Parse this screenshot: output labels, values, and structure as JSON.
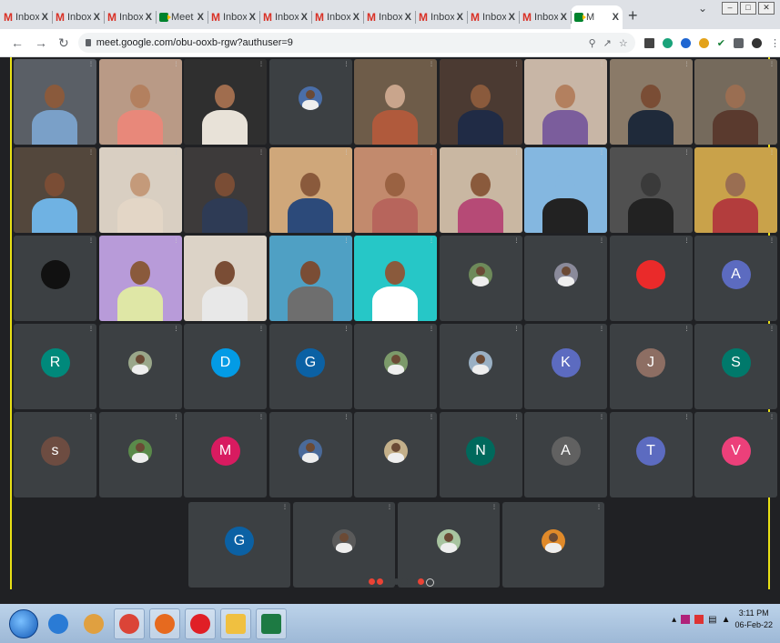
{
  "browser": {
    "tabs": [
      {
        "kind": "gmail",
        "title": "Inbox",
        "active": false
      },
      {
        "kind": "gmail",
        "title": "Inbox",
        "active": false
      },
      {
        "kind": "gmail",
        "title": "Inbox",
        "active": false
      },
      {
        "kind": "meet",
        "title": "Meet",
        "active": false
      },
      {
        "kind": "gmail",
        "title": "Inbox",
        "active": false
      },
      {
        "kind": "gmail",
        "title": "Inbox",
        "active": false
      },
      {
        "kind": "gmail",
        "title": "Inbox",
        "active": false
      },
      {
        "kind": "gmail",
        "title": "Inbox",
        "active": false
      },
      {
        "kind": "gmail",
        "title": "Inbox",
        "active": false
      },
      {
        "kind": "gmail",
        "title": "Inbox",
        "active": false
      },
      {
        "kind": "gmail",
        "title": "Inbox",
        "active": false
      },
      {
        "kind": "meet",
        "title": "M",
        "active": true
      }
    ],
    "close_glyph": "X",
    "new_tab": "+",
    "url": "meet.google.com/obu-ooxb-rgw?authuser=9"
  },
  "participants": [
    {
      "type": "video",
      "name": "",
      "bg": "#5a5f66",
      "skin": "#8a5a3c",
      "shirt": "#7aa0c8"
    },
    {
      "type": "video",
      "name": "",
      "bg": "#b99a86",
      "skin": "#b3805f",
      "shirt": "#e8887a"
    },
    {
      "type": "video",
      "name": "",
      "bg": "#2f2f2f",
      "skin": "#a06d4e",
      "shirt": "#e8e2d8"
    },
    {
      "type": "photo",
      "name": "",
      "color": "#4a6ea8"
    },
    {
      "type": "video",
      "name": "",
      "bg": "#6e5c49",
      "skin": "#c9a58c",
      "shirt": "#b05a3c"
    },
    {
      "type": "video",
      "name": "",
      "bg": "#4b3a32",
      "skin": "#8a5a3c",
      "shirt": "#202b45"
    },
    {
      "type": "video",
      "name": "",
      "bg": "#c8b6a6",
      "skin": "#b3805f",
      "shirt": "#7b5d9c"
    },
    {
      "type": "video",
      "name": "",
      "bg": "#8a7a68",
      "skin": "#7a4d35",
      "shirt": "#1f2a3a"
    },
    {
      "type": "video",
      "name": "",
      "bg": "#756a5c",
      "skin": "#9a6e52",
      "shirt": "#5a3a2e"
    },
    {
      "type": "video",
      "name": "",
      "bg": "#53473c",
      "skin": "#7a4d35",
      "shirt": "#6fb2e3"
    },
    {
      "type": "video",
      "name": "",
      "bg": "#d9cfc2",
      "skin": "#c49a7a",
      "shirt": "#e3d6c6"
    },
    {
      "type": "video",
      "name": "",
      "bg": "#3d3a3a",
      "skin": "#7a4d35",
      "shirt": "#2e3b55"
    },
    {
      "type": "video",
      "name": "",
      "bg": "#cfa77a",
      "skin": "#8a5a3c",
      "shirt": "#2c4a7a"
    },
    {
      "type": "video",
      "name": "",
      "bg": "#c28a6d",
      "skin": "#9a6242",
      "shirt": "#b7655c"
    },
    {
      "type": "video",
      "name": "",
      "bg": "#c9b7a2",
      "skin": "#8a5a3c",
      "shirt": "#b64a76"
    },
    {
      "type": "video",
      "name": "",
      "bg": "#84b7e0",
      "skin": "#84b7e0",
      "shirt": "#222"
    },
    {
      "type": "video",
      "name": "",
      "bg": "#505050",
      "skin": "#3a3a3a",
      "shirt": "#222"
    },
    {
      "type": "video",
      "name": "",
      "bg": "#c9a24a",
      "skin": "#9a6e52",
      "shirt": "#b33d3d"
    },
    {
      "type": "dot",
      "name": "",
      "color": "#111111"
    },
    {
      "type": "video",
      "name": "",
      "bg": "#b89bd9",
      "skin": "#8a5a3c",
      "shirt": "#dfe7a6"
    },
    {
      "type": "video",
      "name": "",
      "bg": "#dcd3c7",
      "skin": "#7a4d35",
      "shirt": "#e8e8e8"
    },
    {
      "type": "video",
      "name": "",
      "bg": "#4fa0c4",
      "skin": "#7a4d35",
      "shirt": "#6e6e6e"
    },
    {
      "type": "video",
      "name": "",
      "bg": "#26c7c7",
      "skin": "#8a5a3c",
      "shirt": "#ffffff"
    },
    {
      "type": "photo",
      "name": "",
      "color": "#6e8a5a"
    },
    {
      "type": "photo",
      "name": "",
      "color": "#8a8a9a"
    },
    {
      "type": "dot",
      "name": "",
      "color": "#ea2a2a"
    },
    {
      "type": "letter",
      "name": "",
      "letter": "A",
      "color": "#5c6bc0"
    },
    {
      "type": "letter",
      "name": "",
      "letter": "R",
      "color": "#00897b"
    },
    {
      "type": "photo",
      "name": "",
      "color": "#9aa78a"
    },
    {
      "type": "letter",
      "name": "",
      "letter": "D",
      "color": "#039be5"
    },
    {
      "type": "letter",
      "name": "",
      "letter": "G",
      "color": "#0b61a4"
    },
    {
      "type": "photo",
      "name": "",
      "color": "#7c9a6a"
    },
    {
      "type": "photo",
      "name": "",
      "color": "#9ab0c4"
    },
    {
      "type": "letter",
      "name": "",
      "letter": "K",
      "color": "#5c6bc0"
    },
    {
      "type": "letter",
      "name": "",
      "letter": "J",
      "color": "#8d6e63"
    },
    {
      "type": "letter",
      "name": "",
      "letter": "S",
      "color": "#00796b"
    },
    {
      "type": "letter",
      "name": "",
      "letter": "s",
      "color": "#6d4c41"
    },
    {
      "type": "photo",
      "name": "",
      "color": "#5a8a4a"
    },
    {
      "type": "letter",
      "name": "",
      "letter": "M",
      "color": "#d81b60"
    },
    {
      "type": "photo",
      "name": "",
      "color": "#4a6a9a"
    },
    {
      "type": "photo",
      "name": "",
      "color": "#c4b08a"
    },
    {
      "type": "letter",
      "name": "",
      "letter": "N",
      "color": "#00695c"
    },
    {
      "type": "letter",
      "name": "",
      "letter": "A",
      "color": "#616161"
    },
    {
      "type": "letter",
      "name": "",
      "letter": "T",
      "color": "#5c6bc0"
    },
    {
      "type": "letter",
      "name": "",
      "letter": "V",
      "color": "#ec407a"
    }
  ],
  "last_row": [
    {
      "type": "letter",
      "name": "",
      "letter": "G",
      "color": "#0b61a4"
    },
    {
      "type": "photo",
      "name": "",
      "color": "#5a5a5a"
    },
    {
      "type": "photo",
      "name": "",
      "color": "#a8c4a0"
    },
    {
      "type": "photo",
      "name": "",
      "color": "#e08a2a"
    }
  ],
  "taskbar": {
    "apps": [
      {
        "name": "ie",
        "color": "#2a7bd5"
      },
      {
        "name": "uc",
        "color": "#e0a040"
      },
      {
        "name": "chrome",
        "color": "#db4437"
      },
      {
        "name": "firefox",
        "color": "#e66a1f"
      },
      {
        "name": "opera",
        "color": "#e01f26"
      },
      {
        "name": "explorer",
        "color": "#f0c040"
      },
      {
        "name": "excel",
        "color": "#1d7a43"
      }
    ],
    "time": "3:11 PM",
    "date": "06-Feb-22"
  }
}
